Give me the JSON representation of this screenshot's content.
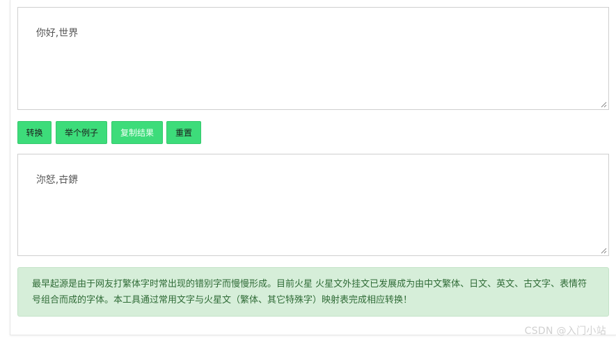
{
  "input_box": {
    "value": "你好,世界"
  },
  "buttons": {
    "convert": "转换",
    "example": "举个例子",
    "copy": "复制结果",
    "reset": "重置"
  },
  "output_box": {
    "value": "沵恏,卋鎅"
  },
  "notice": {
    "text": "最早起源是由于网友打繁体字时常出现的错别字而慢慢形成。目前火星 火星文外挂文已发展成为由中文繁体、日文、英文、古文字、表情符号组合而成的字体。本工具通过常用文字与火星文（繁体、其它特殊字）映射表完成相应转换！"
  },
  "watermark": {
    "text": "CSDN @入门小站"
  },
  "colors": {
    "button_bg": "#3ddc7a",
    "notice_bg": "#d6eed9",
    "notice_text": "#2f6b36"
  }
}
